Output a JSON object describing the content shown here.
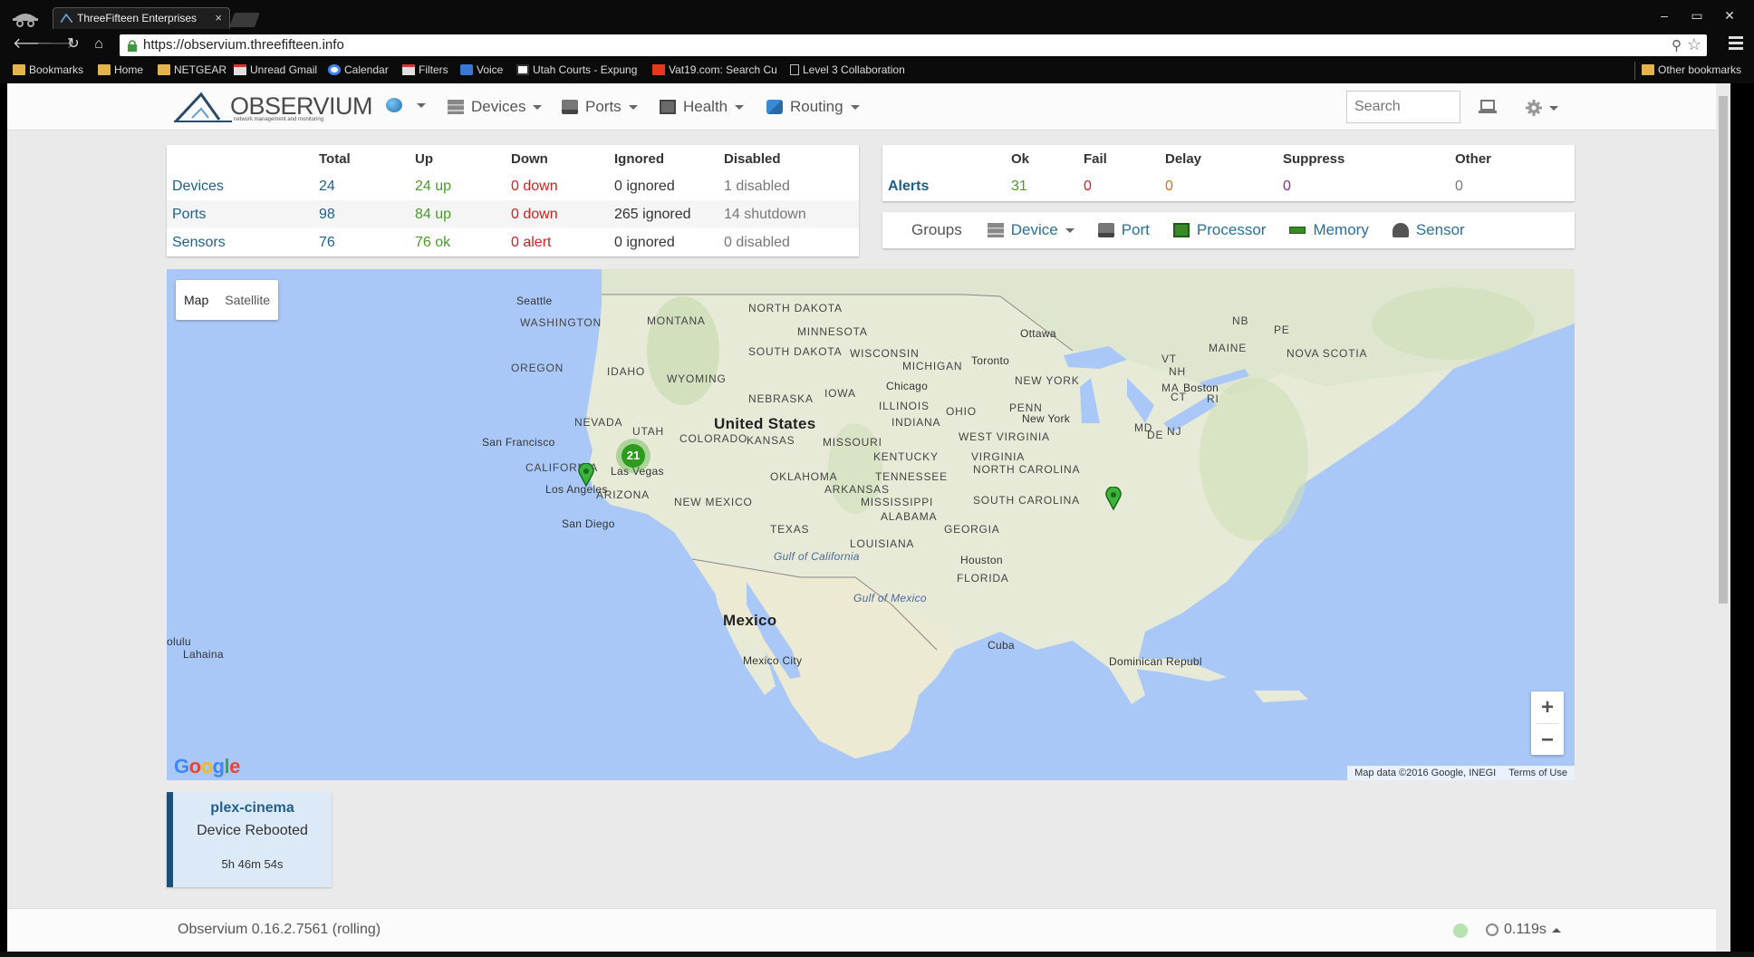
{
  "browser": {
    "tab_title": "ThreeFifteen Enterprises",
    "tab_close": "×",
    "url": "https://observium.threefifteen.info",
    "window_buttons": [
      "–",
      "▭",
      "✕"
    ],
    "nav_icons": [
      "back-icon",
      "forward-icon",
      "reload-icon",
      "home-icon"
    ],
    "bookmarks": [
      {
        "label": "Bookmarks",
        "icon": "folder-icon"
      },
      {
        "label": "Home",
        "icon": "folder-icon"
      },
      {
        "label": "NETGEAR",
        "icon": "folder-icon"
      },
      {
        "label": "Unread Gmail",
        "icon": "gmail-icon"
      },
      {
        "label": "Calendar",
        "icon": "google-icon"
      },
      {
        "label": "Filters",
        "icon": "gmail-icon"
      },
      {
        "label": "Voice",
        "icon": "phone-icon"
      },
      {
        "label": "Utah Courts - Expung",
        "icon": "court-icon"
      },
      {
        "label": "Vat19.com: Search Cu",
        "icon": "vat19-icon"
      },
      {
        "label": "Level 3 Collaboration",
        "icon": "page-icon"
      }
    ],
    "other_bookmarks": "Other bookmarks"
  },
  "app": {
    "logo_text": "OBSERVIUM",
    "logo_sub": "network management and monitoring",
    "nav": [
      {
        "label": "",
        "icon": "globe-icon"
      },
      {
        "label": "Devices",
        "icon": "devices-icon"
      },
      {
        "label": "Ports",
        "icon": "ports-icon"
      },
      {
        "label": "Health",
        "icon": "health-icon"
      },
      {
        "label": "Routing",
        "icon": "routing-icon"
      }
    ],
    "search_placeholder": "Search",
    "accent": "#1f5f8b"
  },
  "status_table": {
    "headers": [
      "",
      "Total",
      "Up",
      "Down",
      "Ignored",
      "Disabled"
    ],
    "rows": [
      {
        "label": "Devices",
        "total": "24",
        "up": "24 up",
        "down": "0 down",
        "ignored": "0 ignored",
        "disabled": "1 disabled"
      },
      {
        "label": "Ports",
        "total": "98",
        "up": "84 up",
        "down": "0 down",
        "ignored": "265 ignored",
        "disabled": "14 shutdown"
      },
      {
        "label": "Sensors",
        "total": "76",
        "up": "76 ok",
        "down": "0 alert",
        "ignored": "0 ignored",
        "disabled": "0 disabled"
      }
    ]
  },
  "alerts_table": {
    "headers": [
      "",
      "Ok",
      "Fail",
      "Delay",
      "Suppress",
      "Other"
    ],
    "row": {
      "label": "Alerts",
      "ok": "31",
      "fail": "0",
      "delay": "0",
      "suppress": "0",
      "other": "0"
    }
  },
  "groups": {
    "label": "Groups",
    "items": [
      {
        "label": "Device",
        "icon": "device-icon"
      },
      {
        "label": "Port",
        "icon": "port-icon"
      },
      {
        "label": "Processor",
        "icon": "processor-icon"
      },
      {
        "label": "Memory",
        "icon": "memory-icon"
      },
      {
        "label": "Sensor",
        "icon": "sensor-icon"
      }
    ]
  },
  "map": {
    "type_buttons": [
      "Map",
      "Satellite"
    ],
    "cluster_count": "21",
    "labels": {
      "states": [
        "WASHINGTON",
        "MONTANA",
        "NORTH DAKOTA",
        "MINNESOTA",
        "OREGON",
        "IDAHO",
        "SOUTH DAKOTA",
        "WYOMING",
        "WISCONSIN",
        "MICHIGAN",
        "NEW YORK",
        "MAINE",
        "NEBRASKA",
        "IOWA",
        "ILLINOIS",
        "INDIANA",
        "OHIO",
        "PENN",
        "NEVADA",
        "UTAH",
        "COLORADO",
        "KANSAS",
        "MISSOURI",
        "KENTUCKY",
        "WEST VIRGINIA",
        "VIRGINIA",
        "CALIFORNIA",
        "ARIZONA",
        "NEW MEXICO",
        "OKLAHOMA",
        "TENNESSEE",
        "NORTH CAROLINA",
        "ARKANSAS",
        "MISSISSIPPI",
        "SOUTH CAROLINA",
        "ALABAMA",
        "GEORGIA",
        "TEXAS",
        "LOUISIANA",
        "FLORIDA",
        "NOVA SCOTIA",
        "NB",
        "PE",
        "VT",
        "NH",
        "MA",
        "CT",
        "RI",
        "MD",
        "DE",
        "NJ"
      ],
      "cities": [
        "Seattle",
        "Ottawa",
        "Toronto",
        "Boston",
        "Chicago",
        "New York",
        "San Francisco",
        "Las Vegas",
        "Los Angeles",
        "San Diego",
        "Houston",
        "Mexico City",
        "Cuba",
        "Dominican Republ",
        "olulu",
        "Lahaina"
      ],
      "countries": [
        "United States",
        "Mexico"
      ],
      "water": [
        "Gulf of California",
        "Gulf of Mexico"
      ]
    },
    "zoom_in": "+",
    "zoom_out": "−",
    "google": "Google",
    "attribution": "Map data ©2016 Google, INEGI",
    "terms": "Terms of Use"
  },
  "event": {
    "host": "plex-cinema",
    "message": "Device Rebooted",
    "time": "5h 46m 54s"
  },
  "footer": {
    "version": "Observium 0.16.2.7561 (rolling)",
    "timing": "0.119s"
  }
}
